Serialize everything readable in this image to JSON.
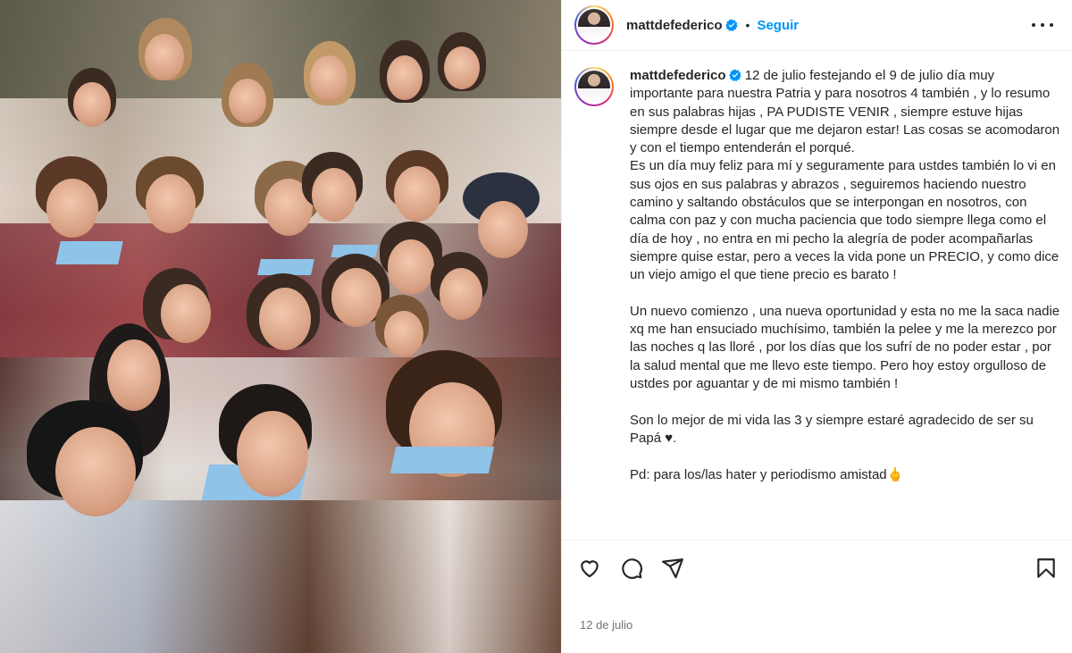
{
  "post": {
    "username": "mattdefederico",
    "follow_label": "Seguir",
    "separator": "•",
    "caption": "12 de julio festejando el 9 de julio día muy importante para nuestra Patria y para nosotros 4 también , y lo resumo en sus palabras hijas , PA PUDISTE VENIR , siempre estuve hijas siempre desde el lugar que me dejaron estar! Las cosas se acomodaron y con el tiempo entenderán el porqué.\nEs un día muy feliz para mí y seguramente para ustdes también lo vi en sus ojos en sus palabras y abrazos , seguiremos haciendo nuestro camino y saltando obstáculos que se interpongan en nosotros, con calma con paz y con mucha paciencia que todo siempre llega como el día de hoy , no entra en mi pecho la alegría de poder acompañarlas siempre quise estar, pero a veces la vida pone un PRECIO, y como dice un viejo amigo el que tiene precio es barato !\n\nUn nuevo comienzo , una nueva oportunidad y esta no me la saca nadie xq me han ensuciado muchísimo, también la pelee y me la merezco por las noches q las lloré , por los días que los sufrí de no poder estar , por la salud mental que me llevo este tiempo. Pero hoy estoy orgulloso de ustdes por aguantar y de mi mismo también !\n\nSon lo mejor de mi vida las 3 y siempre estaré agradecido de ser su Papá ♥.\n\nPd: para los/las hater y periodismo amistad🖕",
    "date": "12 de julio"
  },
  "icons": {
    "verified": "verified-badge-icon",
    "more": "more-options-icon",
    "like": "heart-icon",
    "comment": "comment-icon",
    "share": "share-icon",
    "save": "bookmark-icon"
  },
  "colors": {
    "accent": "#0095f6",
    "text": "#262626",
    "muted": "#737373",
    "border": "#efefef"
  }
}
